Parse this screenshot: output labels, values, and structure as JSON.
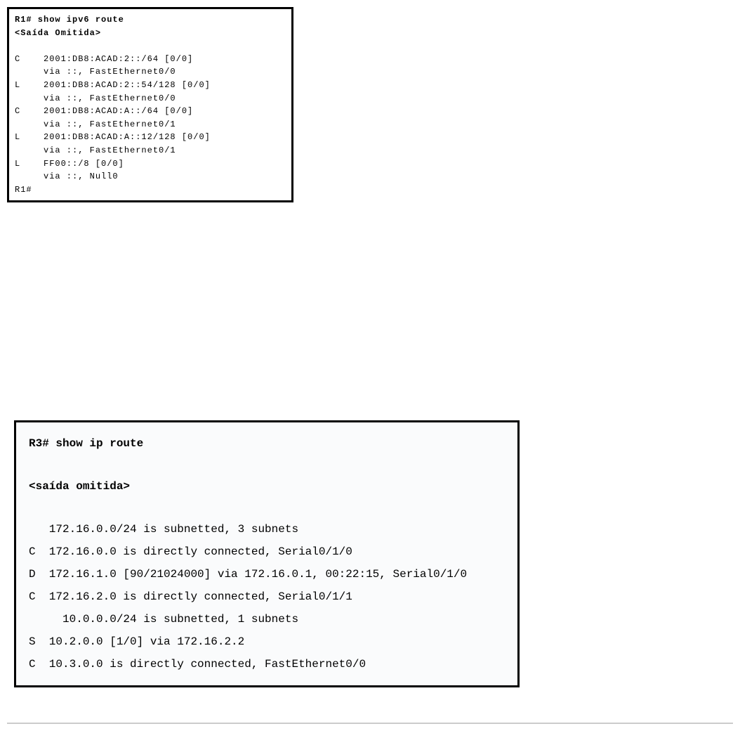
{
  "terminal1": {
    "prompt_cmd": "R1# show ipv6 route",
    "omitted": "<Saída Omitida>",
    "lines": [
      "C    2001:DB8:ACAD:2::/64 [0/0]",
      "     via ::, FastEthernet0/0",
      "L    2001:DB8:ACAD:2::54/128 [0/0]",
      "     via ::, FastEthernet0/0",
      "C    2001:DB8:ACAD:A::/64 [0/0]",
      "     via ::, FastEthernet0/1",
      "L    2001:DB8:ACAD:A::12/128 [0/0]",
      "     via ::, FastEthernet0/1",
      "L    FF00::/8 [0/0]",
      "     via ::, Null0"
    ],
    "end_prompt": "R1#"
  },
  "terminal2": {
    "prompt_cmd": "R3# show ip route",
    "omitted": "<saída omitida>",
    "lines": [
      "   172.16.0.0/24 is subnetted, 3 subnets",
      "C  172.16.0.0 is directly connected, Serial0/1/0",
      "D  172.16.1.0 [90/21024000] via 172.16.0.1, 00:22:15, Serial0/1/0",
      "C  172.16.2.0 is directly connected, Serial0/1/1",
      "     10.0.0.0/24 is subnetted, 1 subnets",
      "S  10.2.0.0 [1/0] via 172.16.2.2",
      "C  10.3.0.0 is directly connected, FastEthernet0/0"
    ]
  }
}
